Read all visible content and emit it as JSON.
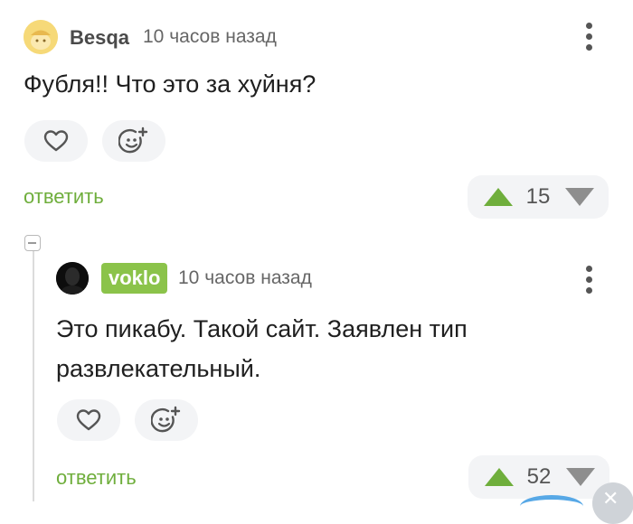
{
  "comments": [
    {
      "username": "Besqa",
      "time": "10 часов назад",
      "text": "Фубля!! Что это за хуйня?",
      "reply_label": "ответить",
      "score": "15"
    },
    {
      "username": "voklo",
      "time": "10 часов назад",
      "text_line1": "Это пикабу. Такой сайт. Заявлен тип",
      "text_line2": "развлекательный.",
      "reply_label": "ответить",
      "score": "52"
    }
  ],
  "icons": {
    "like": "heart-icon",
    "react": "add-emoji-icon",
    "more": "more-vertical-icon",
    "upvote": "arrow-up-icon",
    "downvote": "arrow-down-icon",
    "collapse": "minus-square-icon",
    "close": "close-icon"
  },
  "colors": {
    "accent_green": "#6fae3c",
    "username_badge": "#8bc34a",
    "pill_bg": "#f3f4f6"
  }
}
